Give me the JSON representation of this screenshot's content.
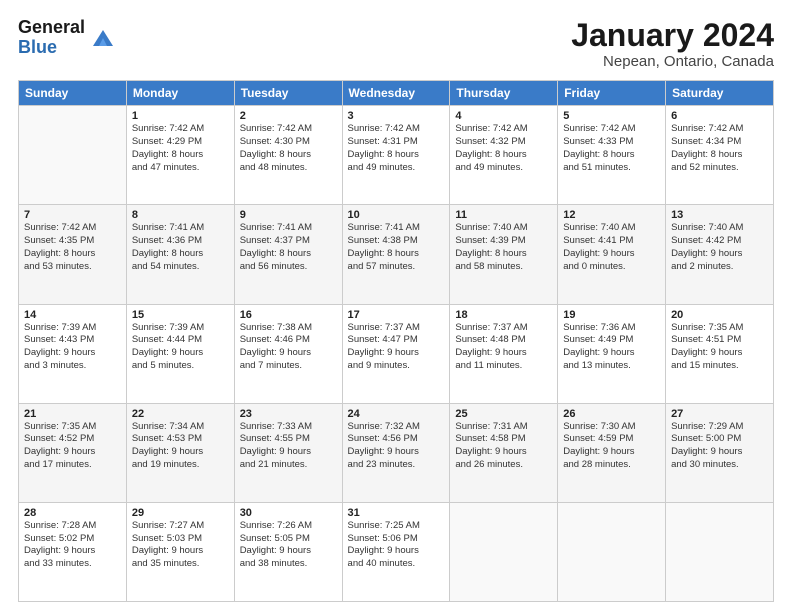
{
  "header": {
    "logo_general": "General",
    "logo_blue": "Blue",
    "title": "January 2024",
    "subtitle": "Nepean, Ontario, Canada"
  },
  "days_of_week": [
    "Sunday",
    "Monday",
    "Tuesday",
    "Wednesday",
    "Thursday",
    "Friday",
    "Saturday"
  ],
  "weeks": [
    [
      {
        "num": "",
        "detail": ""
      },
      {
        "num": "1",
        "detail": "Sunrise: 7:42 AM\nSunset: 4:29 PM\nDaylight: 8 hours\nand 47 minutes."
      },
      {
        "num": "2",
        "detail": "Sunrise: 7:42 AM\nSunset: 4:30 PM\nDaylight: 8 hours\nand 48 minutes."
      },
      {
        "num": "3",
        "detail": "Sunrise: 7:42 AM\nSunset: 4:31 PM\nDaylight: 8 hours\nand 49 minutes."
      },
      {
        "num": "4",
        "detail": "Sunrise: 7:42 AM\nSunset: 4:32 PM\nDaylight: 8 hours\nand 49 minutes."
      },
      {
        "num": "5",
        "detail": "Sunrise: 7:42 AM\nSunset: 4:33 PM\nDaylight: 8 hours\nand 51 minutes."
      },
      {
        "num": "6",
        "detail": "Sunrise: 7:42 AM\nSunset: 4:34 PM\nDaylight: 8 hours\nand 52 minutes."
      }
    ],
    [
      {
        "num": "7",
        "detail": "Sunrise: 7:42 AM\nSunset: 4:35 PM\nDaylight: 8 hours\nand 53 minutes."
      },
      {
        "num": "8",
        "detail": "Sunrise: 7:41 AM\nSunset: 4:36 PM\nDaylight: 8 hours\nand 54 minutes."
      },
      {
        "num": "9",
        "detail": "Sunrise: 7:41 AM\nSunset: 4:37 PM\nDaylight: 8 hours\nand 56 minutes."
      },
      {
        "num": "10",
        "detail": "Sunrise: 7:41 AM\nSunset: 4:38 PM\nDaylight: 8 hours\nand 57 minutes."
      },
      {
        "num": "11",
        "detail": "Sunrise: 7:40 AM\nSunset: 4:39 PM\nDaylight: 8 hours\nand 58 minutes."
      },
      {
        "num": "12",
        "detail": "Sunrise: 7:40 AM\nSunset: 4:41 PM\nDaylight: 9 hours\nand 0 minutes."
      },
      {
        "num": "13",
        "detail": "Sunrise: 7:40 AM\nSunset: 4:42 PM\nDaylight: 9 hours\nand 2 minutes."
      }
    ],
    [
      {
        "num": "14",
        "detail": "Sunrise: 7:39 AM\nSunset: 4:43 PM\nDaylight: 9 hours\nand 3 minutes."
      },
      {
        "num": "15",
        "detail": "Sunrise: 7:39 AM\nSunset: 4:44 PM\nDaylight: 9 hours\nand 5 minutes."
      },
      {
        "num": "16",
        "detail": "Sunrise: 7:38 AM\nSunset: 4:46 PM\nDaylight: 9 hours\nand 7 minutes."
      },
      {
        "num": "17",
        "detail": "Sunrise: 7:37 AM\nSunset: 4:47 PM\nDaylight: 9 hours\nand 9 minutes."
      },
      {
        "num": "18",
        "detail": "Sunrise: 7:37 AM\nSunset: 4:48 PM\nDaylight: 9 hours\nand 11 minutes."
      },
      {
        "num": "19",
        "detail": "Sunrise: 7:36 AM\nSunset: 4:49 PM\nDaylight: 9 hours\nand 13 minutes."
      },
      {
        "num": "20",
        "detail": "Sunrise: 7:35 AM\nSunset: 4:51 PM\nDaylight: 9 hours\nand 15 minutes."
      }
    ],
    [
      {
        "num": "21",
        "detail": "Sunrise: 7:35 AM\nSunset: 4:52 PM\nDaylight: 9 hours\nand 17 minutes."
      },
      {
        "num": "22",
        "detail": "Sunrise: 7:34 AM\nSunset: 4:53 PM\nDaylight: 9 hours\nand 19 minutes."
      },
      {
        "num": "23",
        "detail": "Sunrise: 7:33 AM\nSunset: 4:55 PM\nDaylight: 9 hours\nand 21 minutes."
      },
      {
        "num": "24",
        "detail": "Sunrise: 7:32 AM\nSunset: 4:56 PM\nDaylight: 9 hours\nand 23 minutes."
      },
      {
        "num": "25",
        "detail": "Sunrise: 7:31 AM\nSunset: 4:58 PM\nDaylight: 9 hours\nand 26 minutes."
      },
      {
        "num": "26",
        "detail": "Sunrise: 7:30 AM\nSunset: 4:59 PM\nDaylight: 9 hours\nand 28 minutes."
      },
      {
        "num": "27",
        "detail": "Sunrise: 7:29 AM\nSunset: 5:00 PM\nDaylight: 9 hours\nand 30 minutes."
      }
    ],
    [
      {
        "num": "28",
        "detail": "Sunrise: 7:28 AM\nSunset: 5:02 PM\nDaylight: 9 hours\nand 33 minutes."
      },
      {
        "num": "29",
        "detail": "Sunrise: 7:27 AM\nSunset: 5:03 PM\nDaylight: 9 hours\nand 35 minutes."
      },
      {
        "num": "30",
        "detail": "Sunrise: 7:26 AM\nSunset: 5:05 PM\nDaylight: 9 hours\nand 38 minutes."
      },
      {
        "num": "31",
        "detail": "Sunrise: 7:25 AM\nSunset: 5:06 PM\nDaylight: 9 hours\nand 40 minutes."
      },
      {
        "num": "",
        "detail": ""
      },
      {
        "num": "",
        "detail": ""
      },
      {
        "num": "",
        "detail": ""
      }
    ]
  ]
}
